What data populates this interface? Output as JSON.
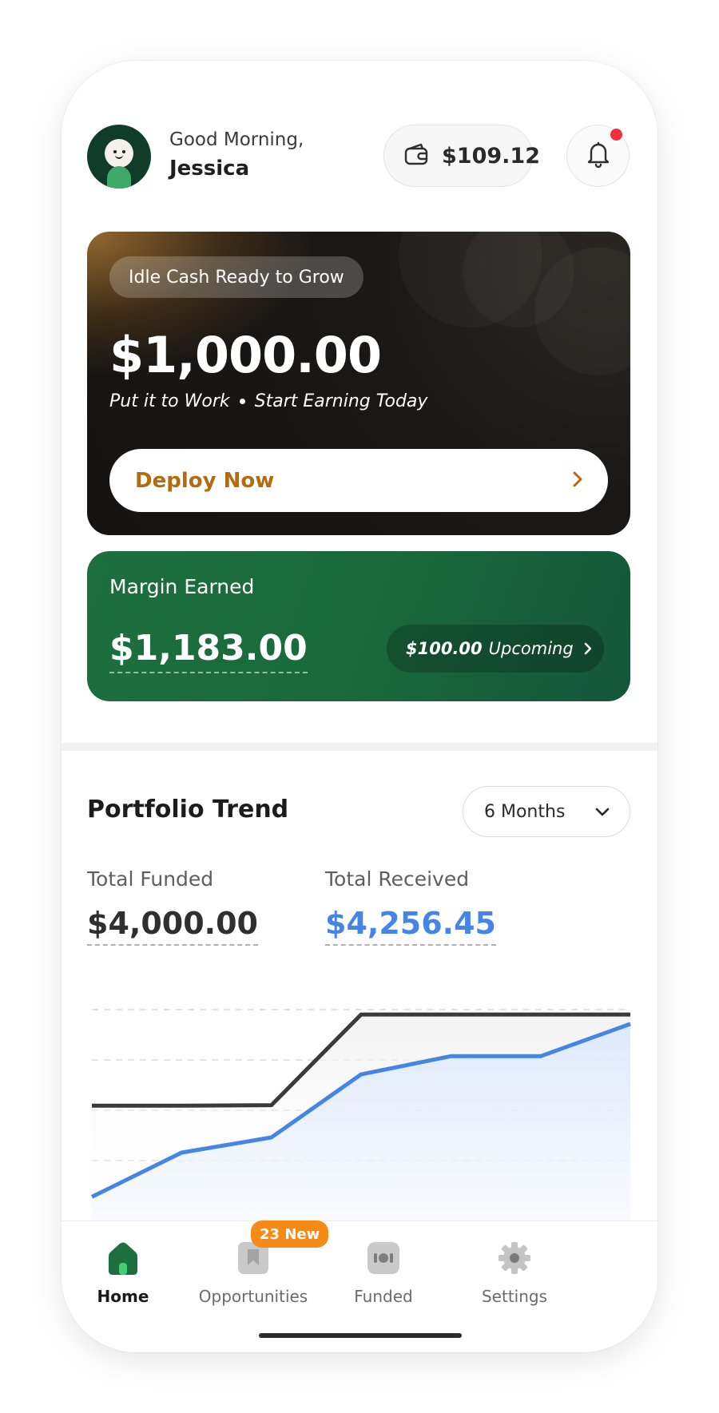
{
  "header": {
    "greeting": "Good Morning,",
    "user_name": "Jessica",
    "wallet_balance": "$109.12",
    "notification_dot_color": "#f0303a"
  },
  "idle_card": {
    "tag": "Idle Cash Ready to Grow",
    "amount": "$1,000.00",
    "subtitle_part1": "Put it to Work",
    "subtitle_part2": "Start Earning Today",
    "cta_label": "Deploy Now",
    "cta_color": "#b36b0f"
  },
  "margin_card": {
    "title": "Margin Earned",
    "amount": "$1,183.00",
    "upcoming_amount": "$100.00",
    "upcoming_label": "Upcoming",
    "background": "#1d6f3f"
  },
  "portfolio": {
    "title": "Portfolio Trend",
    "period_selected": "6 Months",
    "total_funded_label": "Total Funded",
    "total_funded_value": "$4,000.00",
    "total_received_label": "Total Received",
    "total_received_value": "$4,256.45"
  },
  "chart_data": {
    "type": "line",
    "x": [
      0,
      1,
      2,
      3,
      4,
      5,
      6
    ],
    "series": [
      {
        "name": "",
        "color": "#3a3a3a",
        "values": [
          2250,
          2250,
          2260,
          4000,
          4000,
          4000,
          4000
        ]
      },
      {
        "name": "",
        "color": "#4485e6",
        "values": [
          500,
          1350,
          1640,
          2850,
          3200,
          3200,
          3820
        ]
      }
    ],
    "ylim": [
      0,
      4600
    ],
    "grid": true
  },
  "tabbar": {
    "items": [
      {
        "label": "Home",
        "icon": "home-icon",
        "active": true
      },
      {
        "label": "Opportunities",
        "icon": "bookmark-icon",
        "active": false
      },
      {
        "label": "Funded",
        "icon": "funded-icon",
        "active": false
      },
      {
        "label": "Settings",
        "icon": "gear-icon",
        "active": false
      }
    ],
    "opportunities_badge": "23 New"
  }
}
